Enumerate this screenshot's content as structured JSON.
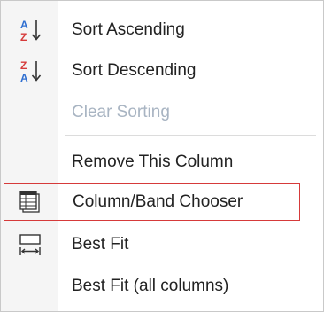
{
  "menu": {
    "items": [
      {
        "label": "Sort Ascending",
        "icon": "sort-ascending-icon",
        "enabled": true
      },
      {
        "label": "Sort Descending",
        "icon": "sort-descending-icon",
        "enabled": true
      },
      {
        "label": "Clear Sorting",
        "icon": "",
        "enabled": false
      },
      {
        "label": "Remove This Column",
        "icon": "",
        "enabled": true
      },
      {
        "label": "Column/Band Chooser",
        "icon": "column-chooser-icon",
        "enabled": true,
        "highlighted": true
      },
      {
        "label": "Best Fit",
        "icon": "best-fit-icon",
        "enabled": true
      },
      {
        "label": "Best Fit (all columns)",
        "icon": "",
        "enabled": true
      }
    ],
    "colors": {
      "accent_blue": "#2f6fd1",
      "accent_red": "#d63a3a",
      "disabled_text": "#a8b4c2",
      "highlight_border": "#d63a3a"
    }
  }
}
